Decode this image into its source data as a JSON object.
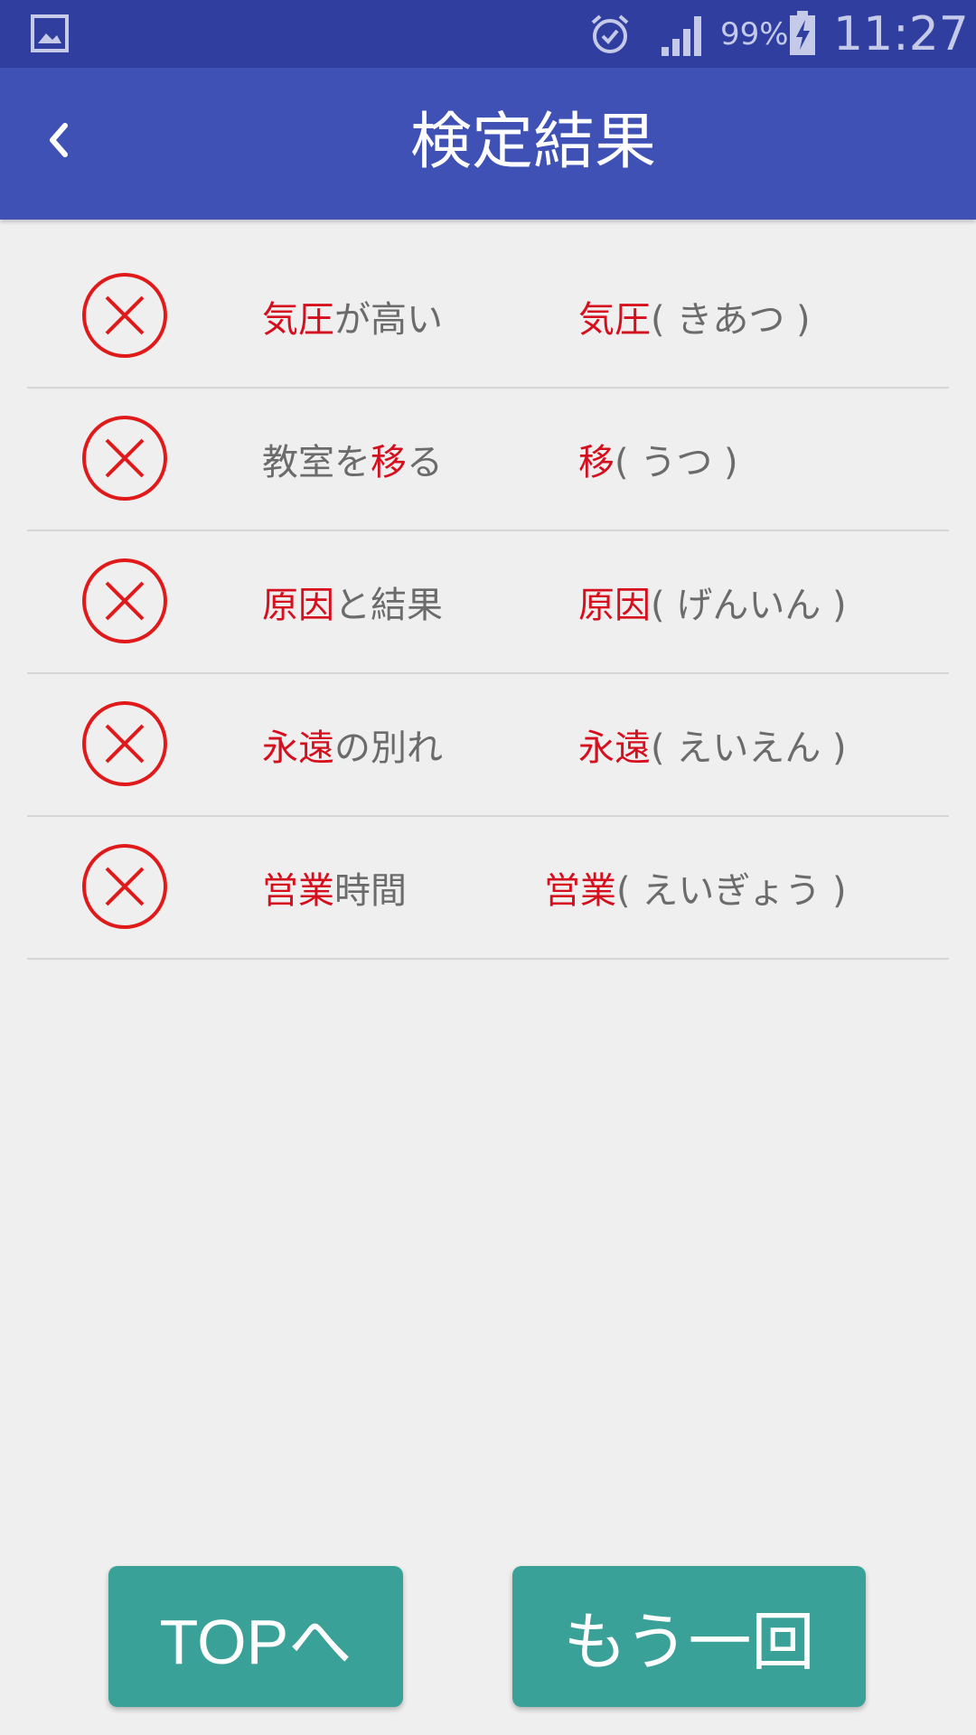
{
  "status_bar": {
    "battery": "99%",
    "time": "11:27",
    "icons": [
      "gallery-icon",
      "alarm-icon",
      "signal-icon",
      "battery-charging-icon"
    ]
  },
  "header": {
    "title": "検定結果",
    "back_icon": "chevron-left-icon"
  },
  "colors": {
    "status_bar": "#303f9f",
    "app_bar": "#3f51b5",
    "background": "#efefef",
    "highlight": "#d50f1e",
    "text": "#6b6b6b",
    "button": "#3aa198",
    "incorrect_mark": "#e01a1a"
  },
  "results": [
    {
      "mark": "incorrect",
      "question": [
        {
          "text": "気圧",
          "hl": true
        },
        {
          "text": "が高い",
          "hl": false
        }
      ],
      "answer": [
        {
          "text": "気圧",
          "hl": true
        },
        {
          "text": "( きあつ )",
          "hl": false
        }
      ]
    },
    {
      "mark": "incorrect",
      "question": [
        {
          "text": "教室を",
          "hl": false
        },
        {
          "text": "移",
          "hl": true
        },
        {
          "text": "る",
          "hl": false
        }
      ],
      "answer": [
        {
          "text": "移",
          "hl": true
        },
        {
          "text": "( うつ )",
          "hl": false
        }
      ]
    },
    {
      "mark": "incorrect",
      "question": [
        {
          "text": "原因",
          "hl": true
        },
        {
          "text": "と結果",
          "hl": false
        }
      ],
      "answer": [
        {
          "text": "原因",
          "hl": true
        },
        {
          "text": "( げんいん )",
          "hl": false
        }
      ]
    },
    {
      "mark": "incorrect",
      "question": [
        {
          "text": "永遠",
          "hl": true
        },
        {
          "text": "の別れ",
          "hl": false
        }
      ],
      "answer": [
        {
          "text": "永遠",
          "hl": true
        },
        {
          "text": "( えいえん )",
          "hl": false
        }
      ]
    },
    {
      "mark": "incorrect",
      "question": [
        {
          "text": "営業",
          "hl": true
        },
        {
          "text": "時間",
          "hl": false
        }
      ],
      "answer": [
        {
          "text": "営業",
          "hl": true
        },
        {
          "text": "( えいぎょう )",
          "hl": false
        }
      ]
    }
  ],
  "buttons": {
    "top_label": "TOPへ",
    "retry_label": "もう一回"
  }
}
